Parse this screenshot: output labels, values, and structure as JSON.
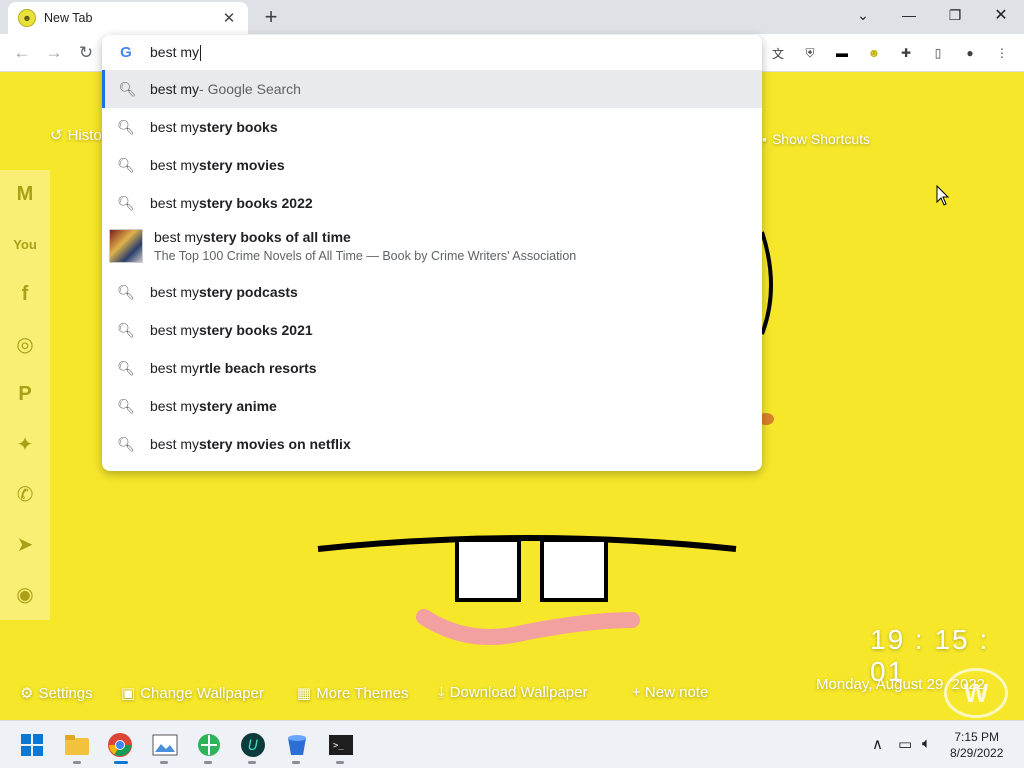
{
  "tab": {
    "title": "New Tab"
  },
  "omnibox": {
    "query": "best my",
    "suggestions": [
      {
        "typed": "best my",
        "rest": "",
        "suffix": " - Google Search"
      },
      {
        "typed": "best my",
        "rest": "stery books"
      },
      {
        "typed": "best my",
        "rest": "stery movies"
      },
      {
        "typed": "best my",
        "rest": "stery books 2022"
      },
      {
        "typed": "best my",
        "rest": "stery books of all time",
        "subtitle": "The Top 100 Crime Novels of All Time — Book by Crime Writers' Association"
      },
      {
        "typed": "best my",
        "rest": "stery podcasts"
      },
      {
        "typed": "best my",
        "rest": "stery books 2021"
      },
      {
        "typed": "best my",
        "rest": "rtle beach resorts"
      },
      {
        "typed": "best my",
        "rest": "stery anime"
      },
      {
        "typed": "best my",
        "rest": "stery movies on netflix"
      }
    ]
  },
  "ntp": {
    "history_label": "Histo",
    "show_shortcuts": "Show Shortcuts",
    "bottom_links": [
      "Settings",
      "Change Wallpaper",
      "More Themes",
      "Download Wallpaper",
      "+ New note"
    ],
    "clock": "19 : 15 : 01",
    "date": "Monday, August 29, 2022",
    "social_icons": [
      "gmail-icon",
      "youtube-icon",
      "facebook-icon",
      "instagram-icon",
      "pinterest-icon",
      "twitter-icon",
      "whatsapp-icon",
      "telegram-icon",
      "reddit-icon"
    ]
  },
  "taskbar": {
    "time": "7:15 PM",
    "date": "8/29/2022"
  },
  "colors": {
    "wallpaper": "#f6e72a",
    "accent": "#1a73e8"
  }
}
